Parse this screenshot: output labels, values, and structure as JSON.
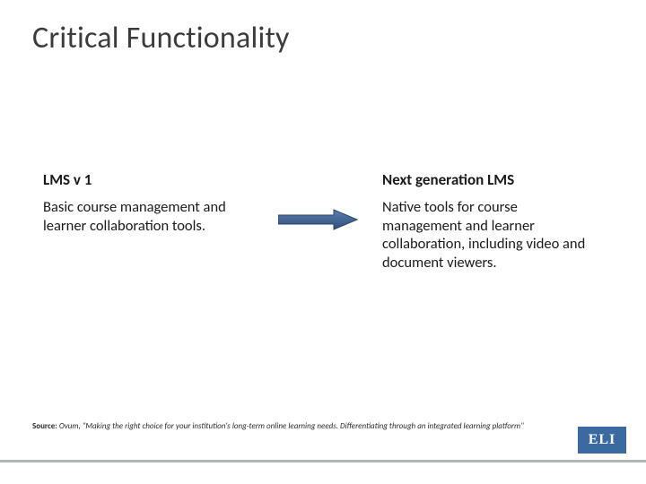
{
  "title": "Critical Functionality",
  "left": {
    "heading": "LMS v 1",
    "body": "Basic course management and learner collaboration tools."
  },
  "right": {
    "heading": "Next generation LMS",
    "body": "Native tools for course management and learner collaboration, including video and document viewers."
  },
  "arrow": {
    "fill": "#385d8a",
    "stroke": "#2a4566"
  },
  "source": {
    "label": "Source:",
    "text": "Ovum, \"Making the right choice for your institution's long-term online learning needs. Differentiating through an integrated learning platform\""
  },
  "logo": {
    "text": "ELI",
    "bg": "#3b6aa0"
  }
}
